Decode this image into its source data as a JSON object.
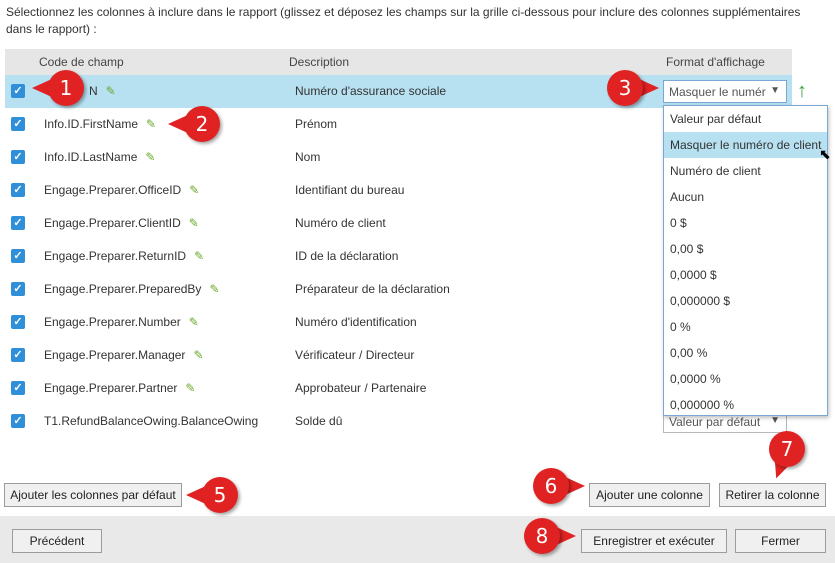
{
  "instructions": "Sélectionnez les colonnes à inclure dans le rapport (glissez et déposez les champs sur la grille ci-dessous pour inclure des colonnes supplémentaires dans le rapport) :",
  "columns": {
    "code": "Code de champ",
    "description": "Description",
    "format": "Format d'affichage"
  },
  "rows": [
    {
      "code": "N",
      "description": "Numéro d'assurance sociale",
      "format": "Masquer le numér"
    },
    {
      "code": "Info.ID.FirstName",
      "description": "Prénom"
    },
    {
      "code": "Info.ID.LastName",
      "description": "Nom"
    },
    {
      "code": "Engage.Preparer.OfficeID",
      "description": "Identifiant du bureau"
    },
    {
      "code": "Engage.Preparer.ClientID",
      "description": "Numéro de client"
    },
    {
      "code": "Engage.Preparer.ReturnID",
      "description": "ID de la déclaration"
    },
    {
      "code": "Engage.Preparer.PreparedBy",
      "description": "Préparateur de la déclaration"
    },
    {
      "code": "Engage.Preparer.Number",
      "description": "Numéro d'identification"
    },
    {
      "code": "Engage.Preparer.Manager",
      "description": "Vérificateur / Directeur"
    },
    {
      "code": "Engage.Preparer.Partner",
      "description": "Approbateur / Partenaire"
    },
    {
      "code": "T1.RefundBalanceOwing.BalanceOwing",
      "description": "Solde dû",
      "format": "Valeur par défaut"
    }
  ],
  "dropdown": {
    "options": [
      "Valeur par défaut",
      "Masquer le numéro de client",
      "Numéro de client",
      "Aucun",
      "0 $",
      "0,00 $",
      "0,0000 $",
      "0,000000 $",
      "0 %",
      "0,00 %",
      "0,0000 %",
      "0,000000 %"
    ],
    "highlighted": "Masquer le numéro de client"
  },
  "buttons": {
    "add_defaults": "Ajouter les colonnes par défaut",
    "add_column": "Ajouter une colonne",
    "remove_column": "Retirer la colonne",
    "previous": "Précédent",
    "save_run": "Enregistrer et exécuter",
    "close": "Fermer"
  },
  "callouts": [
    "1",
    "2",
    "3",
    "5",
    "6",
    "7",
    "8"
  ],
  "icons": {
    "edit": "pencil-icon",
    "move_up": "arrow-up-icon",
    "checkbox": "checkmark-icon"
  },
  "colors": {
    "accent": "#2f8fd8",
    "selected_row": "#b7e0f0",
    "callout": "#e02222",
    "pencil": "#6aaa2a"
  }
}
